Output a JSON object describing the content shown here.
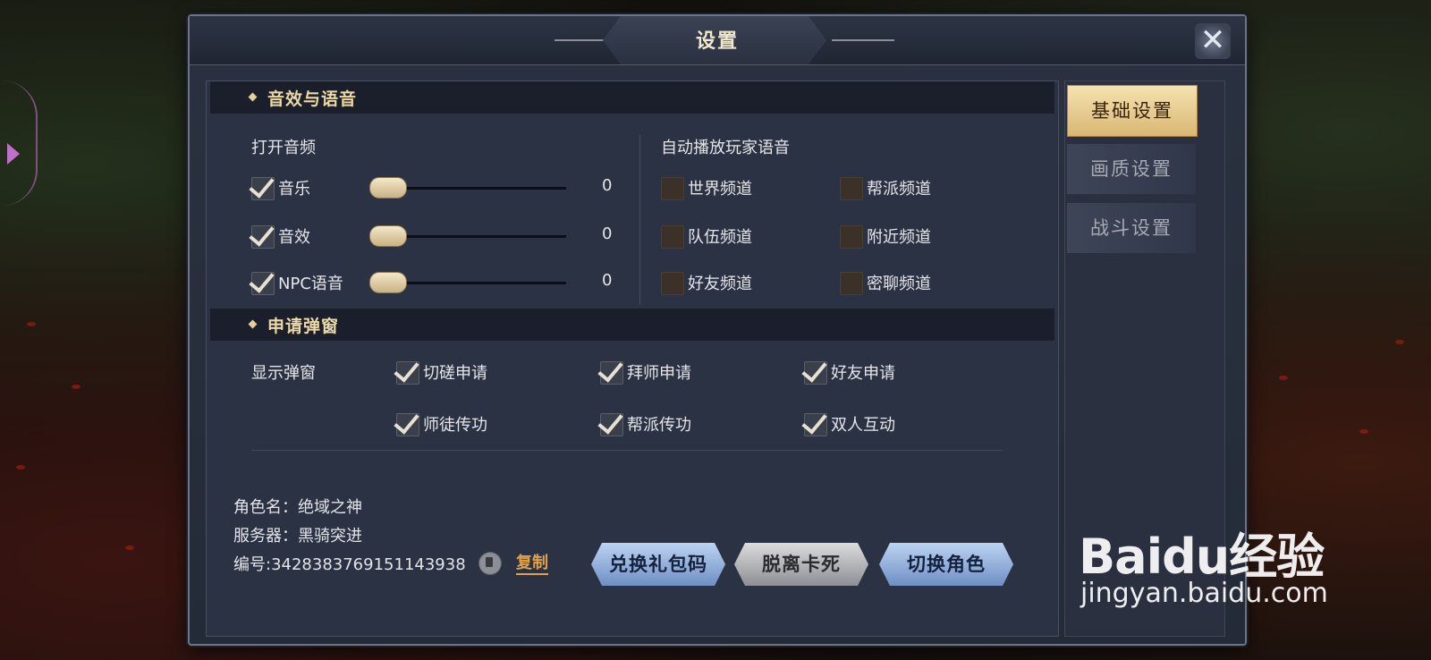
{
  "dialog": {
    "title": "设置",
    "close_symbol": "✕"
  },
  "tabs": [
    {
      "label": "基础设置",
      "active": true
    },
    {
      "label": "画质设置",
      "active": false
    },
    {
      "label": "战斗设置",
      "active": false
    }
  ],
  "audio": {
    "section_title": "音效与语音",
    "open_label": "打开音频",
    "items": [
      {
        "label": "音乐",
        "checked": true,
        "value": "0"
      },
      {
        "label": "音效",
        "checked": true,
        "value": "0"
      },
      {
        "label": "NPC语音",
        "checked": true,
        "value": "0"
      }
    ],
    "autoplay_label": "自动播放玩家语音",
    "channels": [
      {
        "label": "世界频道",
        "checked": false
      },
      {
        "label": "帮派频道",
        "checked": false
      },
      {
        "label": "队伍频道",
        "checked": false
      },
      {
        "label": "附近频道",
        "checked": false
      },
      {
        "label": "好友频道",
        "checked": false
      },
      {
        "label": "密聊频道",
        "checked": false
      }
    ]
  },
  "popup": {
    "section_title": "申请弹窗",
    "show_label": "显示弹窗",
    "items": [
      {
        "label": "切磋申请",
        "checked": true
      },
      {
        "label": "拜师申请",
        "checked": true
      },
      {
        "label": "好友申请",
        "checked": true
      },
      {
        "label": "师徒传功",
        "checked": true
      },
      {
        "label": "帮派传功",
        "checked": true
      },
      {
        "label": "双人互动",
        "checked": true
      }
    ]
  },
  "character": {
    "name_line": "角色名：绝域之神",
    "server_line": "服务器：黑骑突进",
    "id_line": "编号:3428383769151143938",
    "copy_label": "复制"
  },
  "buttons": {
    "redeem": "兑换礼包码",
    "unstuck": "脱离卡死",
    "switch_role": "切换角色"
  },
  "watermark": {
    "logo": "Baidu经验",
    "url": "jingyan.baidu.com"
  },
  "colors": {
    "accent_gold": "#ecd9a6",
    "link_orange": "#e0a14c",
    "panel_bg": "#2b3243"
  }
}
